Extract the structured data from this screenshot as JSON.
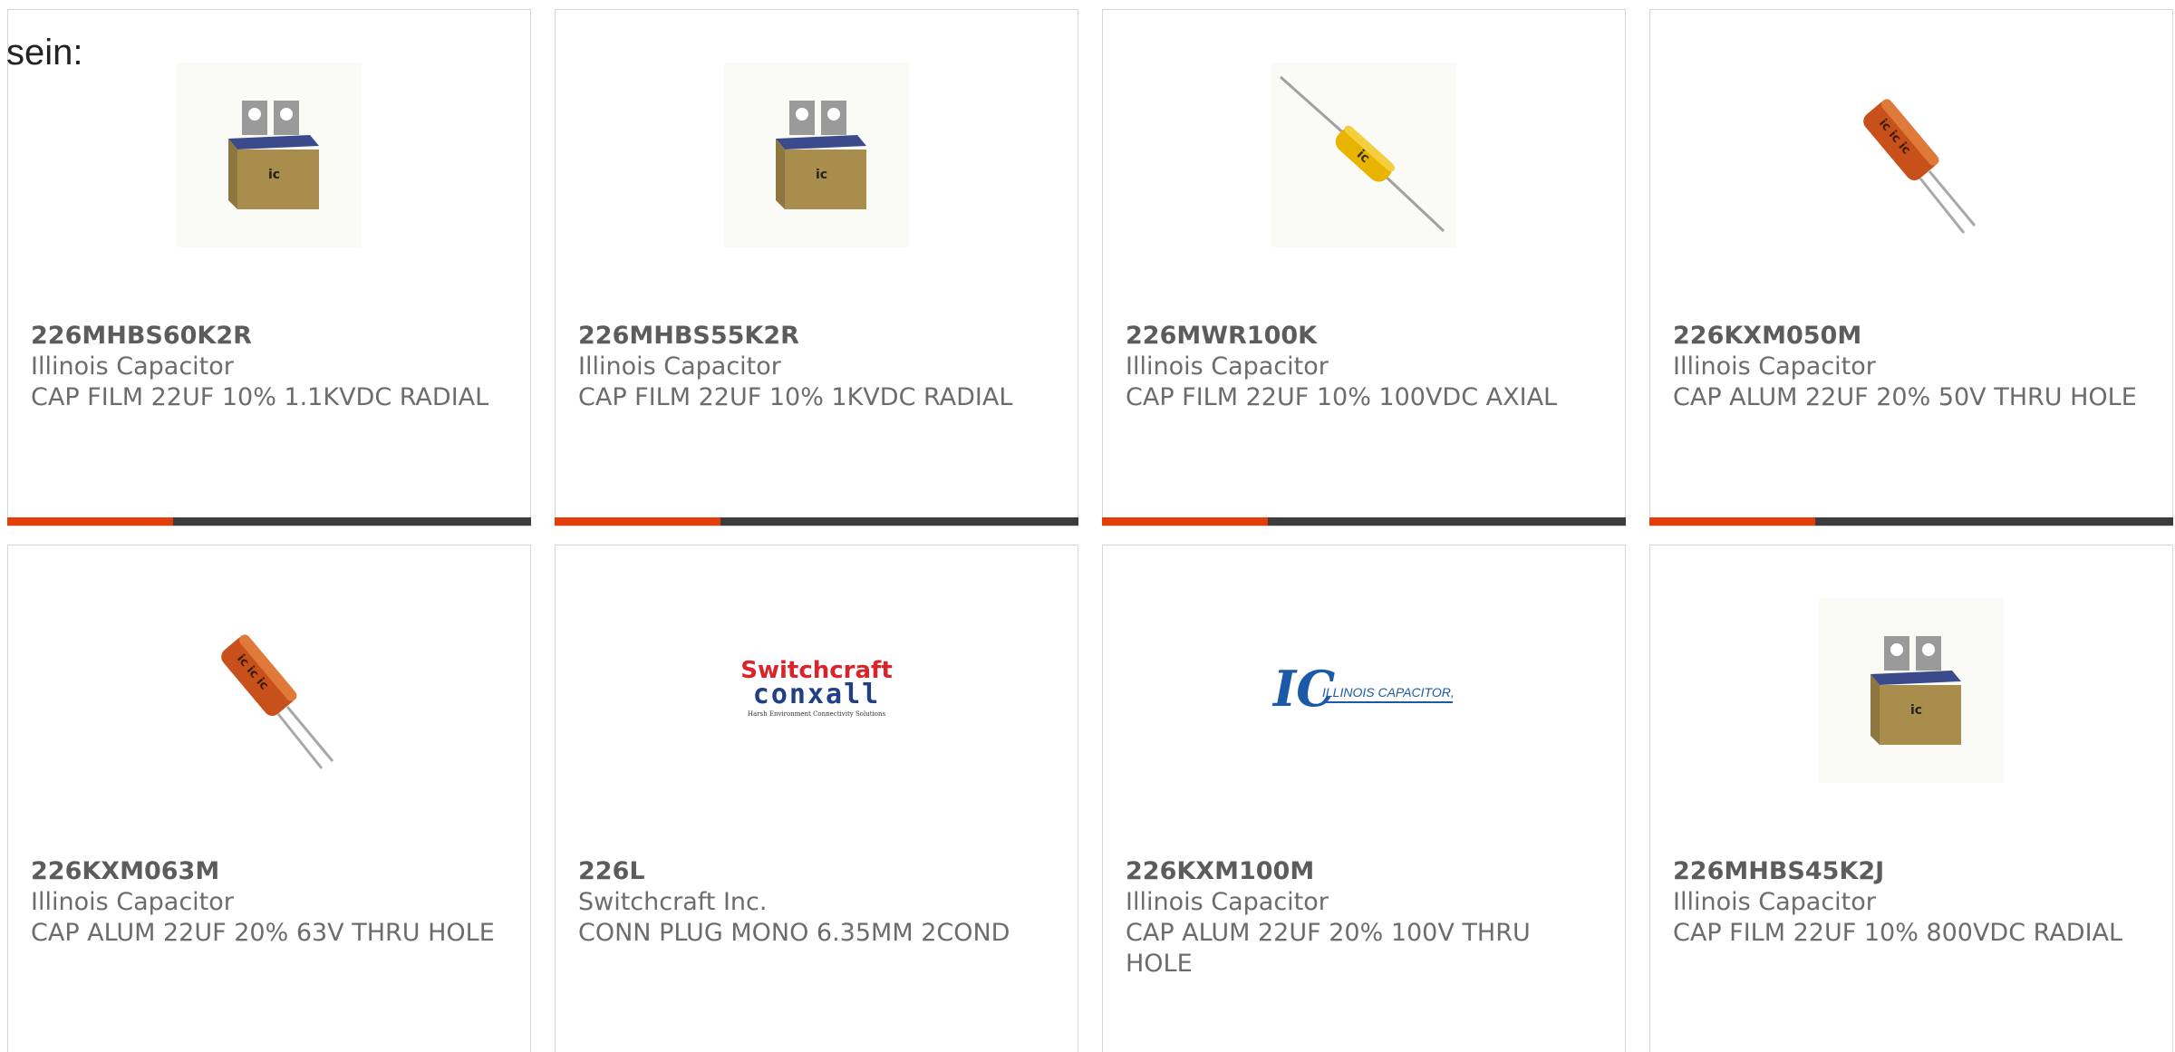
{
  "page": {
    "fragment_text": "sein:"
  },
  "colors": {
    "accent": "#e23d0a",
    "bar": "#3c3c3c",
    "border": "#d6d6d6",
    "text": "#6c6c6c"
  },
  "products": [
    {
      "part_number": "226MHBS60K2R",
      "manufacturer": "Illinois Capacitor",
      "description": "CAP FILM 22UF 10% 1.1KVDC RADIAL",
      "image": "box-film-capacitor"
    },
    {
      "part_number": "226MHBS55K2R",
      "manufacturer": "Illinois Capacitor",
      "description": "CAP FILM 22UF 10% 1KVDC RADIAL",
      "image": "box-film-capacitor"
    },
    {
      "part_number": "226MWR100K",
      "manufacturer": "Illinois Capacitor",
      "description": "CAP FILM 22UF 10% 100VDC AXIAL",
      "image": "axial-capacitor"
    },
    {
      "part_number": "226KXM050M",
      "manufacturer": "Illinois Capacitor",
      "description": "CAP ALUM 22UF 20% 50V THRU HOLE",
      "image": "electrolytic-capacitor"
    },
    {
      "part_number": "226KXM063M",
      "manufacturer": "Illinois Capacitor",
      "description": "CAP ALUM 22UF 20% 63V THRU HOLE",
      "image": "electrolytic-capacitor"
    },
    {
      "part_number": "226L",
      "manufacturer": "Switchcraft Inc.",
      "description": "CONN PLUG MONO 6.35MM 2COND",
      "image": "switchcraft-conxall-logo",
      "logo": {
        "line1": "Switchcraft",
        "line2": "conxall",
        "tagline": "Harsh Environment Connectivity Solutions"
      }
    },
    {
      "part_number": "226KXM100M",
      "manufacturer": "Illinois Capacitor",
      "description": "CAP ALUM 22UF 20% 100V THRU HOLE",
      "image": "illinois-capacitor-logo",
      "logo": {
        "mark": "IC",
        "text": "ILLINOIS CAPACITOR, INC."
      }
    },
    {
      "part_number": "226MHBS45K2J",
      "manufacturer": "Illinois Capacitor",
      "description": "CAP FILM 22UF 10% 800VDC RADIAL",
      "image": "box-film-capacitor"
    }
  ]
}
